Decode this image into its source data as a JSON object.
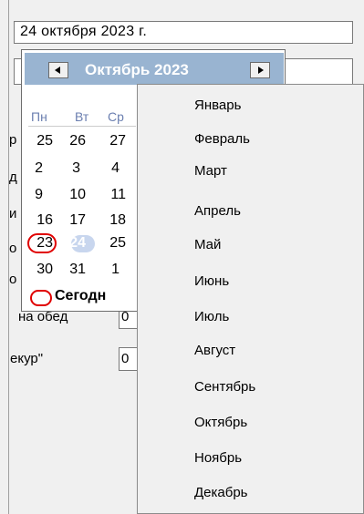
{
  "date_field": {
    "value": "24  октября  2023 г."
  },
  "background": {
    "label_lunch": "на обед",
    "label_ekur": "екур\"",
    "input_lunch_value": "0",
    "input_ekur_value": "0",
    "partial_letters": [
      "р",
      "д",
      "и",
      "о",
      "о"
    ]
  },
  "calendar": {
    "month_title": "Октябрь 2023",
    "weekdays": [
      "Пн",
      "Вт",
      "Ср"
    ],
    "weeks": [
      [
        "25",
        "26",
        "27"
      ],
      [
        "2",
        "3",
        "4"
      ],
      [
        "9",
        "10",
        "11"
      ],
      [
        "16",
        "17",
        "18"
      ],
      [
        "23",
        "24",
        "25"
      ],
      [
        "30",
        "31",
        "1"
      ]
    ],
    "today_label": "Сегодн"
  },
  "month_menu": {
    "items": [
      "Январь",
      "Февраль",
      "Март",
      "Апрель",
      "Май",
      "Июнь",
      "Июль",
      "Август",
      "Сентябрь",
      "Октябрь",
      "Ноябрь",
      "Декабрь"
    ]
  },
  "colors": {
    "header": "#99b4d1",
    "annotation": "#e00000",
    "today_highlight": "#c8d6ee"
  }
}
